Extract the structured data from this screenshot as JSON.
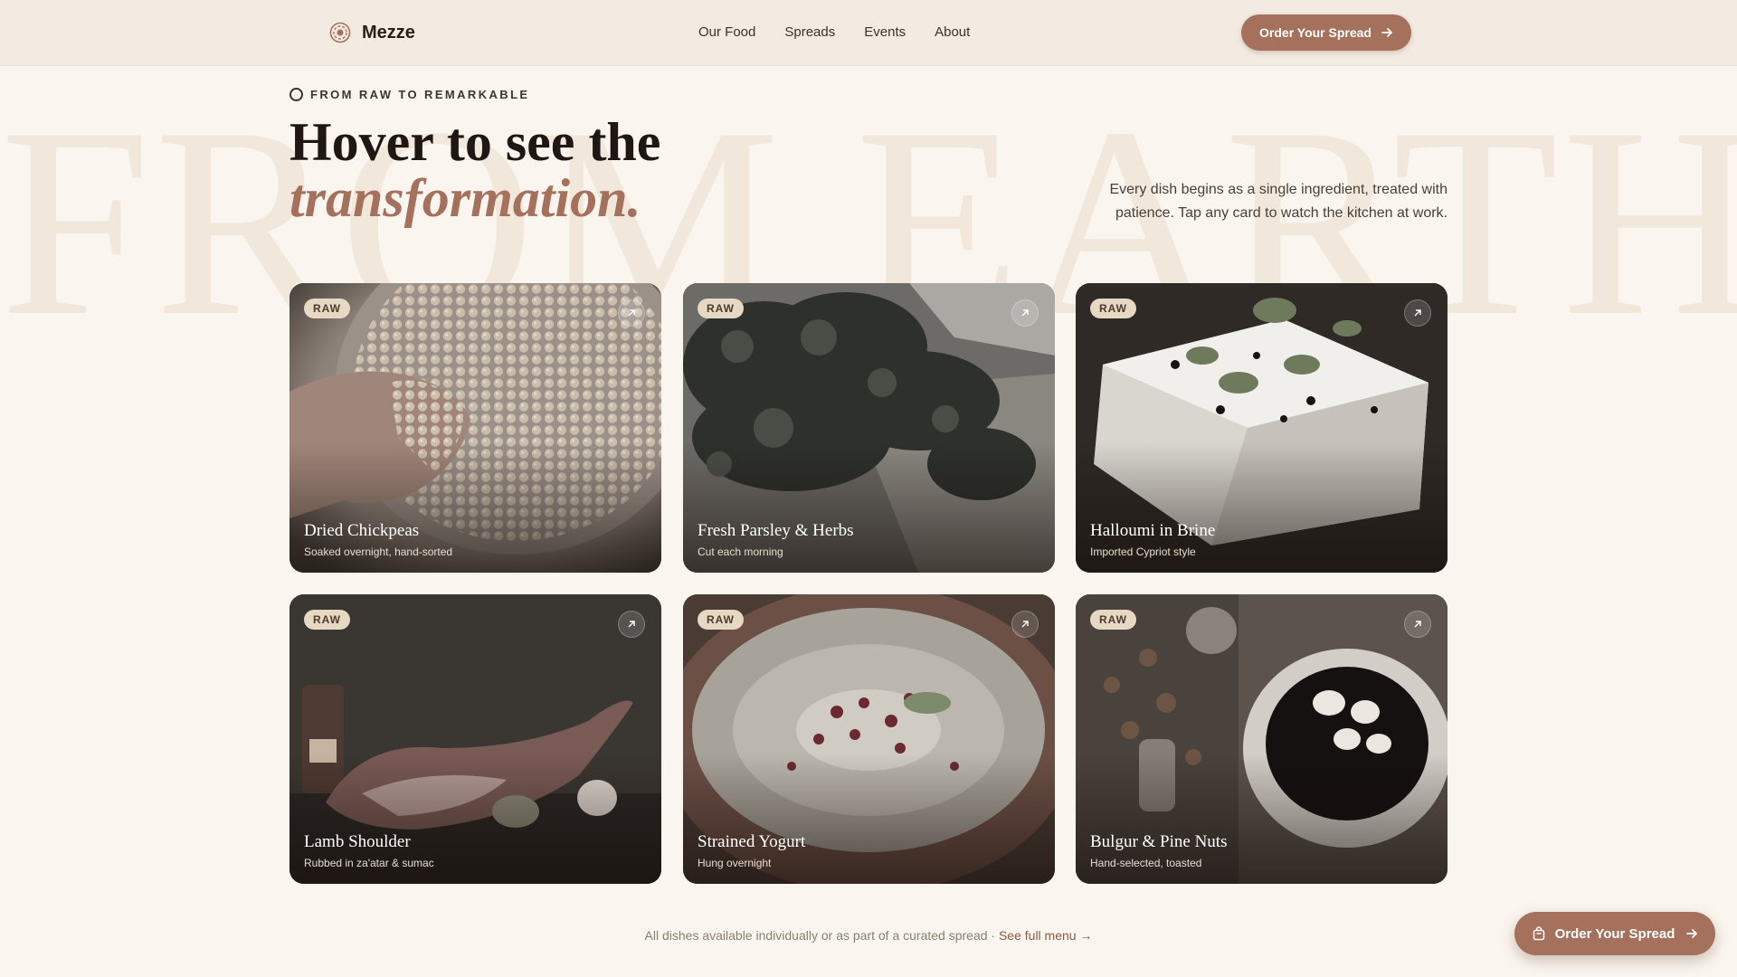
{
  "brand": {
    "name": "Mezze",
    "logo_icon": "logo-spiral-icon",
    "accent": "#a5705c"
  },
  "nav": {
    "links": [
      "Our Food",
      "Spreads",
      "Events",
      "About"
    ],
    "cta_label": "Order Your Spread"
  },
  "background_word": "FROM EARTH",
  "hero": {
    "eyebrow": "FROM RAW TO REMARKABLE",
    "title_line1": "Hover to see the",
    "title_line2": "transformation.",
    "intro": "Every dish begins as a single ingredient, treated with patience. Tap any card to watch the kitchen at work."
  },
  "cards": [
    {
      "badge": "RAW",
      "title": "Dried Chickpeas",
      "subtitle": "Soaked overnight, hand-sorted"
    },
    {
      "badge": "RAW",
      "title": "Fresh Parsley & Herbs",
      "subtitle": "Cut each morning"
    },
    {
      "badge": "RAW",
      "title": "Halloumi in Brine",
      "subtitle": "Imported Cypriot style"
    },
    {
      "badge": "RAW",
      "title": "Lamb Shoulder",
      "subtitle": "Rubbed in za'atar & sumac"
    },
    {
      "badge": "RAW",
      "title": "Strained Yogurt",
      "subtitle": "Hung overnight"
    },
    {
      "badge": "RAW",
      "title": "Bulgur & Pine Nuts",
      "subtitle": "Hand-selected, toasted"
    }
  ],
  "footer": {
    "note": "All dishes available individually or as part of a curated spread · ",
    "link": "See full menu →"
  },
  "floating_cta": {
    "label": "Order Your Spread",
    "icon": "shopping-bag-icon"
  }
}
